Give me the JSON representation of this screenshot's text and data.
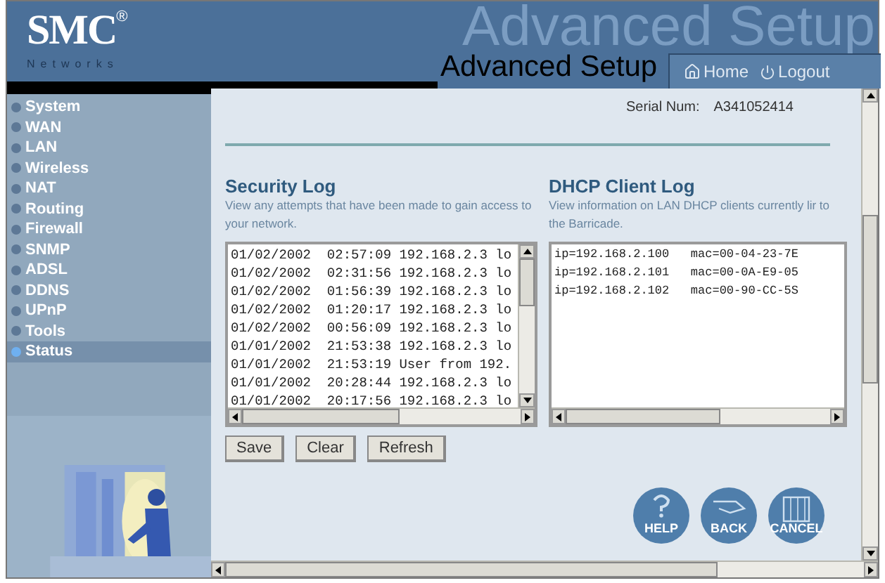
{
  "header": {
    "logo": "SMC",
    "logo_mark": "®",
    "logo_sub": "Networks",
    "banner_text": "Advanced Setup",
    "title": "Advanced Setup",
    "links": [
      {
        "label": "Home",
        "kind": "home"
      },
      {
        "label": "Logout",
        "kind": "logout"
      }
    ]
  },
  "sidebar": {
    "items": [
      {
        "label": "System",
        "selected": false
      },
      {
        "label": "WAN",
        "selected": false
      },
      {
        "label": "LAN",
        "selected": false
      },
      {
        "label": "Wireless",
        "selected": false
      },
      {
        "label": "NAT",
        "selected": false
      },
      {
        "label": "Routing",
        "selected": false
      },
      {
        "label": "Firewall",
        "selected": false
      },
      {
        "label": "SNMP",
        "selected": false
      },
      {
        "label": "ADSL",
        "selected": false
      },
      {
        "label": "DDNS",
        "selected": false
      },
      {
        "label": "UPnP",
        "selected": false
      },
      {
        "label": "Tools",
        "selected": false
      },
      {
        "label": "Status",
        "selected": true
      }
    ]
  },
  "serial": {
    "label": "Serial Num:",
    "value": "A341052414"
  },
  "security_log": {
    "title": "Security Log",
    "description": "View any attempts that have been made to gain access to your network.",
    "lines": [
      "01/02/2002  02:57:09 192.168.2.3 lo",
      "01/02/2002  02:31:56 192.168.2.3 lo",
      "01/02/2002  01:56:39 192.168.2.3 lo",
      "01/02/2002  01:20:17 192.168.2.3 lo",
      "01/02/2002  00:56:09 192.168.2.3 lo",
      "01/01/2002  21:53:38 192.168.2.3 lo",
      "01/01/2002  21:53:19 User from 192.",
      "01/01/2002  20:28:44 192.168.2.3 lo",
      "01/01/2002  20:17:56 192.168.2.3 lo"
    ],
    "buttons": [
      "Save",
      "Clear",
      "Refresh"
    ]
  },
  "dhcp_log": {
    "title": "DHCP Client Log",
    "description": "View information on LAN DHCP clients currently lir to the Barricade.",
    "lines": [
      "ip=192.168.2.100   mac=00-04-23-7E",
      "ip=192.168.2.101   mac=00-0A-E9-05",
      "ip=192.168.2.102   mac=00-90-CC-5S"
    ]
  },
  "round_buttons": [
    {
      "label": "HELP",
      "kind": "help"
    },
    {
      "label": "BACK",
      "kind": "back"
    },
    {
      "label": "CANCEL",
      "kind": "cancel"
    }
  ]
}
